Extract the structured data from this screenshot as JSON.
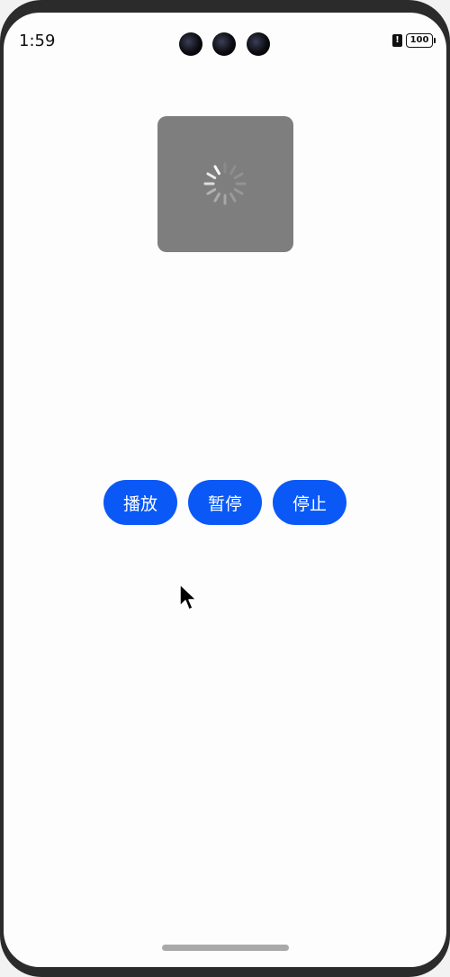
{
  "status_bar": {
    "time": "1:59",
    "alert": "!",
    "battery": "100"
  },
  "video": {
    "state_icon": "loading-spinner-icon"
  },
  "controls": {
    "play_label": "播放",
    "pause_label": "暂停",
    "stop_label": "停止"
  },
  "colors": {
    "accent": "#0a59f7",
    "video_background": "#7e7e7e",
    "screen_background": "#fdfdfd"
  }
}
